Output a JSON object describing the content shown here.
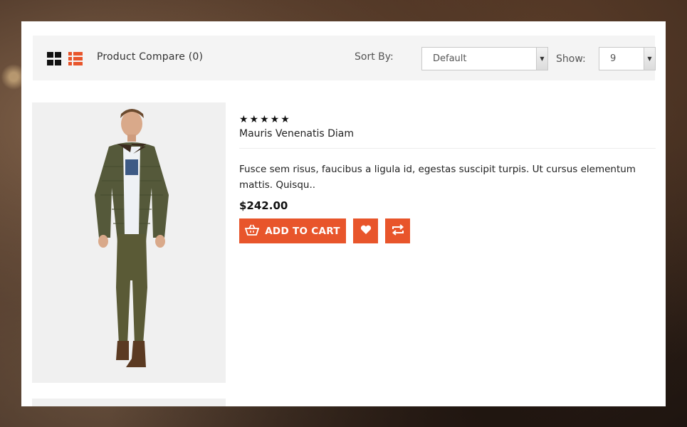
{
  "toolbar": {
    "grid_view": "grid-view-icon",
    "list_view": "list-view-icon",
    "product_compare": "Product Compare (0)",
    "sort_by_label": "Sort By:",
    "sort_value": "Default",
    "show_label": "Show:",
    "show_value": "9"
  },
  "product": {
    "rating": "★★★★★",
    "rating_value": 5,
    "name": "Mauris Venenatis Diam",
    "description": "Fusce sem risus, faucibus a ligula id, egestas suscipit turpis. Ut cursus elementum mattis. Quisqu..",
    "price": "$242.00",
    "add_to_cart": "ADD TO CART"
  },
  "colors": {
    "accent": "#e8552b",
    "toolbar_bg": "#f4f4f4",
    "image_bg": "#f0f0f0"
  }
}
